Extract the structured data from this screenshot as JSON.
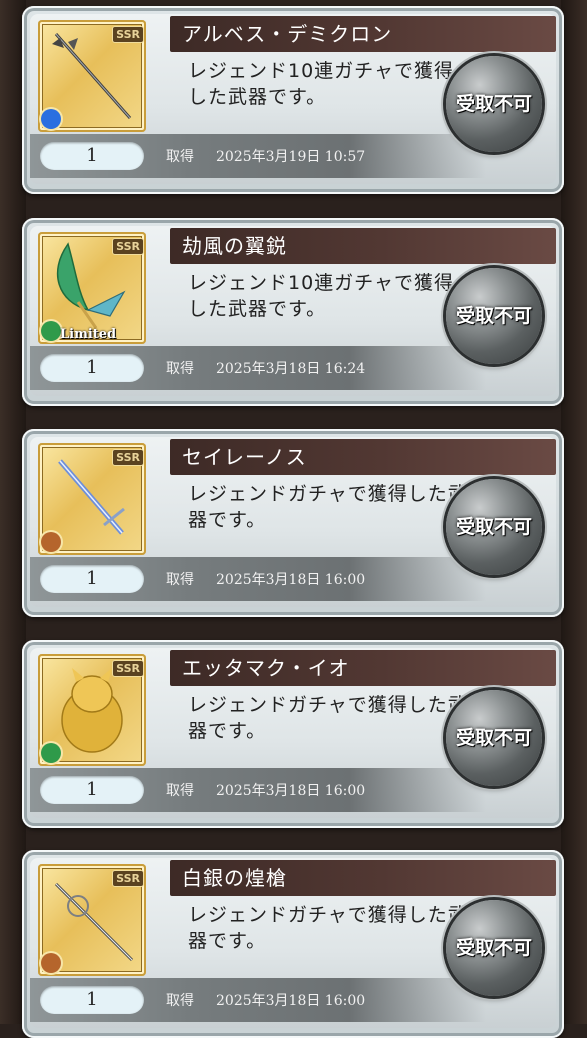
{
  "claim_label": "受取不可",
  "acquired_label": "取得",
  "items": [
    {
      "name": "アルベス・デミクロン",
      "description": "レジェンド10連ガチャで獲得した武器です。",
      "quantity": "1",
      "acquired_date": "2025年3月19日 10:57",
      "rarity": "SSR",
      "element_color": "#2a6fe0",
      "limited": "",
      "icon": "spear-icon"
    },
    {
      "name": "劫風の翼鋭",
      "description": "レジェンド10連ガチャで獲得した武器です。",
      "quantity": "1",
      "acquired_date": "2025年3月18日 16:24",
      "rarity": "SSR",
      "element_color": "#2f9a4a",
      "limited": "Limited",
      "icon": "feather-blade-icon"
    },
    {
      "name": "セイレーノス",
      "description": "レジェンドガチャで獲得した武器です。",
      "quantity": "1",
      "acquired_date": "2025年3月18日 16:00",
      "rarity": "SSR",
      "element_color": "#b5652c",
      "limited": "",
      "icon": "sword-icon"
    },
    {
      "name": "エッタマク・イオ",
      "description": "レジェンドガチャで獲得した武器です。",
      "quantity": "1",
      "acquired_date": "2025年3月18日 16:00",
      "rarity": "SSR",
      "element_color": "#2f9a4a",
      "limited": "",
      "icon": "golden-idol-icon"
    },
    {
      "name": "白銀の煌槍",
      "description": "レジェンドガチャで獲得した武器です。",
      "quantity": "1",
      "acquired_date": "2025年3月18日 16:00",
      "rarity": "SSR",
      "element_color": "#b5652c",
      "limited": "",
      "icon": "silver-lance-icon"
    }
  ]
}
